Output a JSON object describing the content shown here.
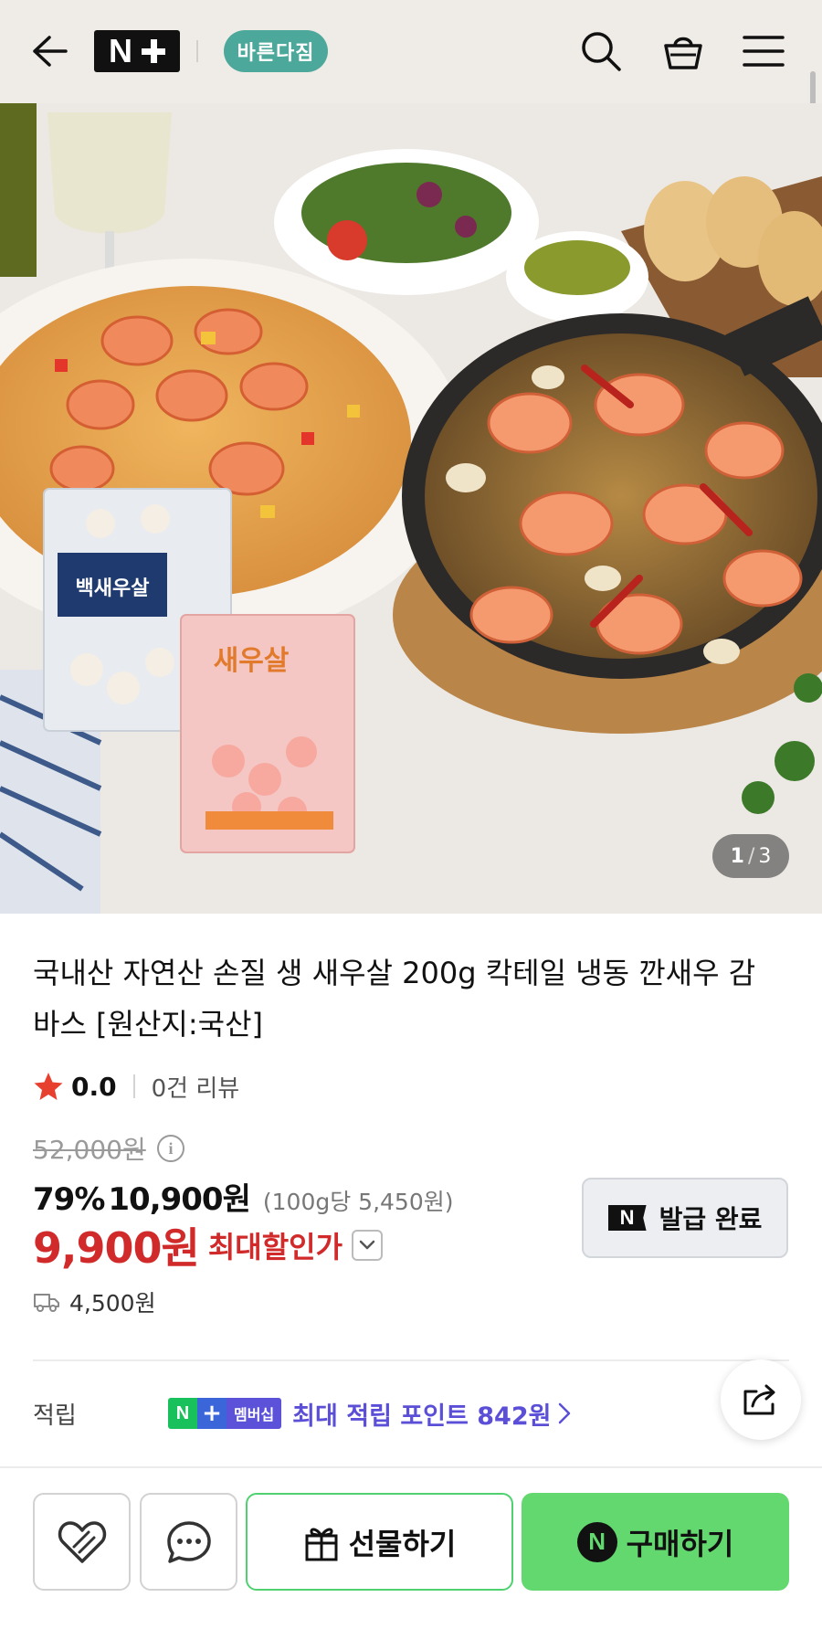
{
  "header": {
    "back_icon": "arrow-left-icon",
    "logo_text": "N+",
    "store_name": "바른다짐",
    "search_icon": "search-icon",
    "cart_icon": "shopping-basket-icon",
    "menu_icon": "hamburger-menu-icon"
  },
  "hero": {
    "current_image": "1",
    "total_images": "3",
    "separator": "/",
    "package_labels": [
      "백새우살",
      "새우살"
    ]
  },
  "product": {
    "title": "국내산 자연산 손질 생 새우살 200g 칵테일 냉동 깐새우 감바스 [원산지:국산]",
    "rating": "0.0",
    "review_count": "0건 리뷰",
    "original_price": "52,000원",
    "discount_rate": "79%",
    "sale_price": "10,900원",
    "unit_price": "(100g당 5,450원)",
    "max_discount_price": "9,900원",
    "max_discount_label": "최대할인가",
    "shipping_fee": "4,500원"
  },
  "coupon": {
    "label": "발급 완료",
    "icon_text": "N"
  },
  "points": {
    "label": "적립",
    "badge_n": "N",
    "badge_plus": "+",
    "badge_text": "멤버십",
    "text": "최대 적립 포인트 842원"
  },
  "bottom_bar": {
    "wishlist_icon": "heart-icon",
    "chat_icon": "chat-bubble-icon",
    "gift_label": "선물하기",
    "buy_icon_text": "N",
    "buy_label": "구매하기"
  },
  "colors": {
    "header_bg": "#efebe6",
    "price_red": "#d12a2a",
    "points_purple": "#5a4fd6",
    "buy_green": "#62d86e",
    "gift_border": "#4fd170",
    "store_badge": "#4ca89a"
  }
}
